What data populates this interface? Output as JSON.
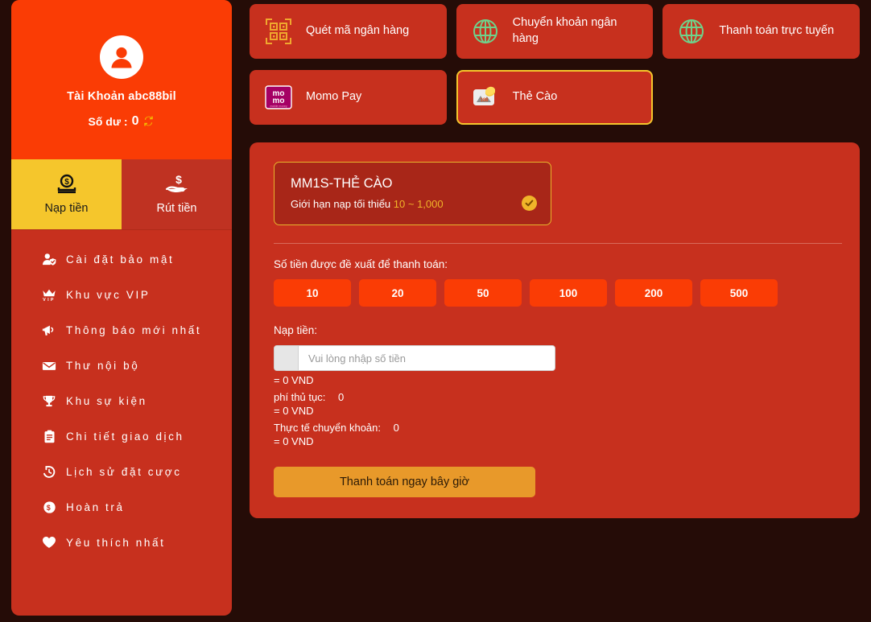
{
  "sidebar": {
    "profile": {
      "avatar_icon": "user-avatar-icon",
      "account_label": "Tài Khoản abc88bil",
      "balance_label": "Số dư :",
      "balance_value": "0",
      "refresh_icon": "refresh-icon"
    },
    "tabs": [
      {
        "label": "Nạp tiền",
        "icon": "deposit-coin-icon",
        "active": true
      },
      {
        "label": "Rút tiền",
        "icon": "withdraw-hand-icon",
        "active": false
      }
    ],
    "menu": [
      {
        "label": "Cài đặt bảo mật",
        "icon": "user-shield-icon"
      },
      {
        "label": "Khu vực VIP",
        "icon": "vip-crown-icon"
      },
      {
        "label": "Thông báo mới nhất",
        "icon": "megaphone-icon"
      },
      {
        "label": "Thư nội bộ",
        "icon": "envelope-icon"
      },
      {
        "label": "Khu sự kiện",
        "icon": "trophy-icon"
      },
      {
        "label": "Chi tiết giao dịch",
        "icon": "clipboard-icon"
      },
      {
        "label": "Lịch sử đặt cược",
        "icon": "history-clock-icon"
      },
      {
        "label": "Hoàn trả",
        "icon": "dollar-circle-icon"
      },
      {
        "label": "Yêu thích nhất",
        "icon": "heart-icon"
      }
    ]
  },
  "methods": [
    {
      "label": "Quét mã ngân hàng",
      "icon": "qr-code-icon",
      "selected": false
    },
    {
      "label": "Chuyển khoản ngân hàng",
      "icon": "globe-icon",
      "selected": false
    },
    {
      "label": "Thanh toán trực tuyến",
      "icon": "globe-icon",
      "selected": false
    },
    {
      "label": "Momo Pay",
      "icon": "momo-logo-icon",
      "selected": false
    },
    {
      "label": "Thẻ Cào",
      "icon": "scratch-card-icon",
      "selected": true
    }
  ],
  "panel": {
    "product": {
      "title": "MM1S-THẺ CÀO",
      "limit_prefix": "Giới hạn nạp tối thiểu",
      "limit_range": "10 ~ 1,000",
      "selected_icon": "check-circle-icon"
    },
    "suggest_label": "Số tiền được đề xuất để thanh toán:",
    "amounts": [
      "10",
      "20",
      "50",
      "100",
      "200",
      "500"
    ],
    "deposit_label": "Nạp tiền:",
    "input_placeholder": "Vui lòng nhập số tiền",
    "input_value": "",
    "calc": {
      "amount_vnd": "= 0 VND",
      "fee_label": "phí thủ tục:",
      "fee_value": "0",
      "fee_vnd": "= 0 VND",
      "actual_label": "Thực tế chuyển khoản:",
      "actual_value": "0",
      "actual_vnd": "= 0 VND"
    },
    "pay_button": "Thanh toán ngay bây giờ"
  },
  "colors": {
    "page_bg": "#250c07",
    "panel_red": "#c7301e",
    "bright_orange": "#fa3c05",
    "accent_yellow": "#f5c62c",
    "card_red": "#a82618",
    "pay_orange": "#e8992a",
    "globe_green": "#6fd18a",
    "momo_magenta": "#a50064"
  }
}
